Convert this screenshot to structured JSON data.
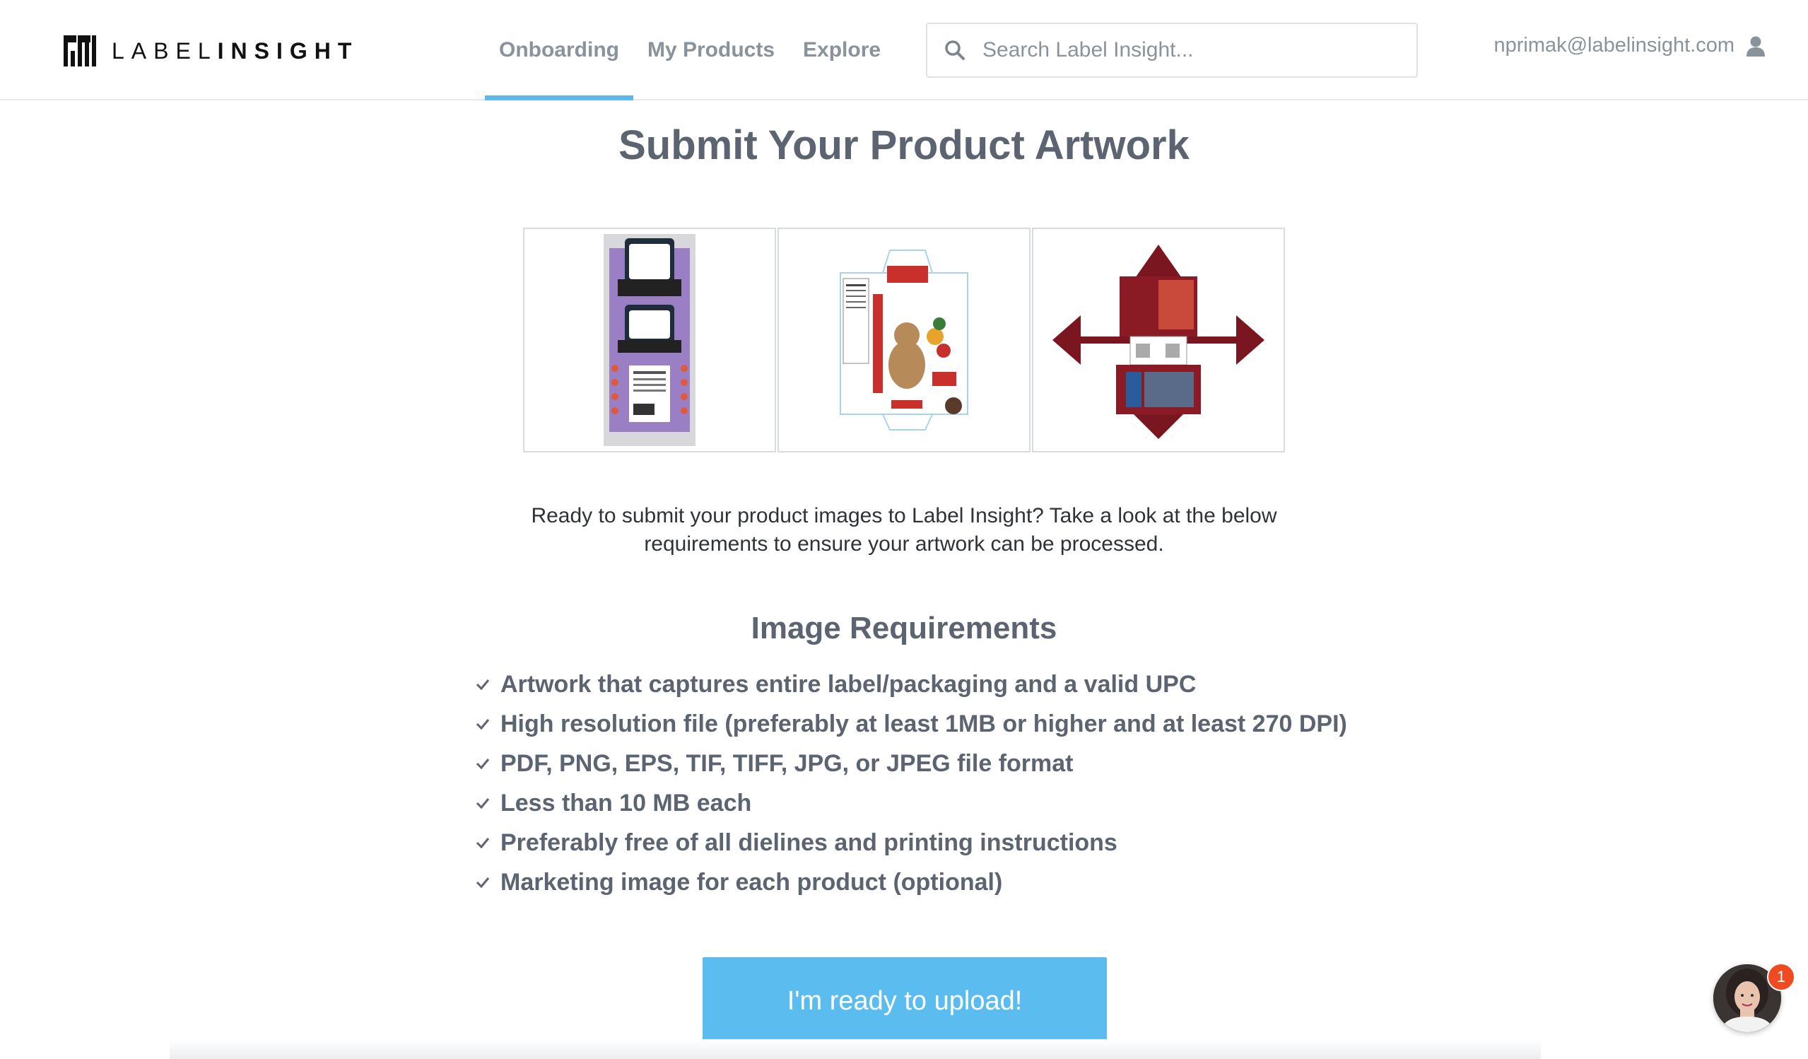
{
  "header": {
    "logo_text_light": "LABEL",
    "logo_text_bold": "INSIGHT",
    "nav": [
      {
        "label": "Onboarding",
        "active": true
      },
      {
        "label": "My Products",
        "active": false
      },
      {
        "label": "Explore",
        "active": false
      }
    ],
    "search_placeholder": "Search Label Insight...",
    "user_email": "nprimak@labelinsight.com"
  },
  "main": {
    "title": "Submit Your Product Artwork",
    "intro_line1": "Ready to submit your product images to Label Insight? Take a look at the below",
    "intro_line2": "requirements to ensure your artwork can be processed.",
    "requirements_title": "Image Requirements",
    "requirements": [
      "Artwork that captures entire label/packaging and a valid UPC",
      "High resolution file (preferably at least 1MB or higher and at least 270 DPI)",
      "PDF, PNG, EPS, TIF, TIFF, JPG, or JPEG file format",
      "Less than 10 MB each",
      "Preferably free of all dielines and printing instructions",
      "Marketing image for each product (optional)"
    ],
    "upload_button": "I'm ready to upload!"
  },
  "thumbnails": [
    {
      "name": "gluten-free-package-artwork"
    },
    {
      "name": "marzipan-box-dieline-artwork"
    },
    {
      "name": "red-box-dieline-artwork"
    }
  ],
  "chat": {
    "badge_count": "1"
  },
  "colors": {
    "accent": "#5bbcf0",
    "text": "#5b6470",
    "badge": "#f04a23"
  }
}
